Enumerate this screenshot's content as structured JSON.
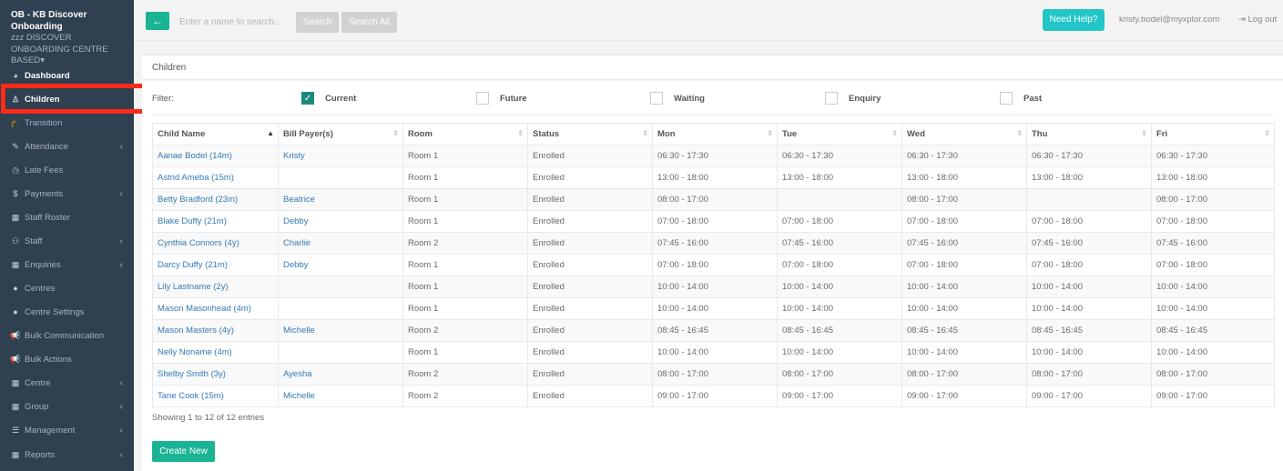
{
  "sidebar": {
    "org_name": "OB - KB Discover Onboarding",
    "org_sub": "zzz DISCOVER ONBOARDING CENTRE BASED",
    "org_caret": "▾",
    "items": [
      {
        "label": "Dashboard",
        "icon": "dashboard-icon",
        "glyph": "◕",
        "chevron": ""
      },
      {
        "label": "Children",
        "icon": "child-icon",
        "glyph": "♙",
        "chevron": ""
      },
      {
        "label": "Transition",
        "icon": "graduation-cap-icon",
        "glyph": "🎓",
        "chevron": ""
      },
      {
        "label": "Attendance",
        "icon": "edit-icon",
        "glyph": "✎",
        "chevron": "‹"
      },
      {
        "label": "Late Fees",
        "icon": "clock-icon",
        "glyph": "◷",
        "chevron": ""
      },
      {
        "label": "Payments",
        "icon": "dollar-icon",
        "glyph": "$",
        "chevron": "‹"
      },
      {
        "label": "Staff Roster",
        "icon": "calendar-icon",
        "glyph": "▦",
        "chevron": ""
      },
      {
        "label": "Staff",
        "icon": "sitemap-icon",
        "glyph": "⚇",
        "chevron": "‹"
      },
      {
        "label": "Enquiries",
        "icon": "grid-icon",
        "glyph": "▦",
        "chevron": "‹"
      },
      {
        "label": "Centres",
        "icon": "circle-icon",
        "glyph": "●",
        "chevron": ""
      },
      {
        "label": "Centre Settings",
        "icon": "circle-icon",
        "glyph": "●",
        "chevron": ""
      },
      {
        "label": "Bulk Communication",
        "icon": "bullhorn-icon",
        "glyph": "📢",
        "chevron": ""
      },
      {
        "label": "Bulk Actions",
        "icon": "bullhorn-icon",
        "glyph": "📢",
        "chevron": ""
      },
      {
        "label": "Centre",
        "icon": "grid-icon",
        "glyph": "▦",
        "chevron": "‹"
      },
      {
        "label": "Group",
        "icon": "grid-icon",
        "glyph": "▦",
        "chevron": "‹"
      },
      {
        "label": "Management",
        "icon": "list-icon",
        "glyph": "☰",
        "chevron": "‹"
      },
      {
        "label": "Reports",
        "icon": "grid-icon",
        "glyph": "▦",
        "chevron": "‹"
      }
    ]
  },
  "topbar": {
    "back_glyph": "←",
    "search_placeholder": "Enter a name to search...",
    "search_label": "Search",
    "search_all_label": "Search All",
    "help_label": "Need Help?",
    "email": "kristy.bodel@myxplor.com",
    "logout_label": "⇥  Log out"
  },
  "panel": {
    "title": "Children"
  },
  "filter": {
    "label": "Filter:",
    "options": [
      {
        "label": "Current",
        "checked": true
      },
      {
        "label": "Future",
        "checked": false
      },
      {
        "label": "Waiting",
        "checked": false
      },
      {
        "label": "Enquiry",
        "checked": false
      },
      {
        "label": "Past",
        "checked": false
      }
    ]
  },
  "table": {
    "columns": [
      "Child Name",
      "Bill Payer(s)",
      "Room",
      "Status",
      "Mon",
      "Tue",
      "Wed",
      "Thu",
      "Fri"
    ],
    "rows": [
      [
        "Aanae Bodel (14m)",
        "Kristy",
        "Room 1",
        "Enrolled",
        "06:30 - 17:30",
        "06:30 - 17:30",
        "06:30 - 17:30",
        "06:30 - 17:30",
        "06:30 - 17:30"
      ],
      [
        "Astrid Ameba (15m)",
        "",
        "Room 1",
        "Enrolled",
        "13:00 - 18:00",
        "13:00 - 18:00",
        "13:00 - 18:00",
        "13:00 - 18:00",
        "13:00 - 18:00"
      ],
      [
        "Betty Bradford (23m)",
        "Beatrice",
        "Room 1",
        "Enrolled",
        "08:00 - 17:00",
        "",
        "08:00 - 17:00",
        "",
        "08:00 - 17:00"
      ],
      [
        "Blake Duffy (21m)",
        "Debby",
        "Room 1",
        "Enrolled",
        "07:00 - 18:00",
        "07:00 - 18:00",
        "07:00 - 18:00",
        "07:00 - 18:00",
        "07:00 - 18:00"
      ],
      [
        "Cynthia Connors (4y)",
        "Charlie",
        "Room 2",
        "Enrolled",
        "07:45 - 16:00",
        "07:45 - 16:00",
        "07:45 - 16:00",
        "07:45 - 16:00",
        "07:45 - 16:00"
      ],
      [
        "Darcy Duffy (21m)",
        "Debby",
        "Room 1",
        "Enrolled",
        "07:00 - 18:00",
        "07:00 - 18:00",
        "07:00 - 18:00",
        "07:00 - 18:00",
        "07:00 - 18:00"
      ],
      [
        "Lily Lastname (2y)",
        "",
        "Room 1",
        "Enrolled",
        "10:00 - 14:00",
        "10:00 - 14:00",
        "10:00 - 14:00",
        "10:00 - 14:00",
        "10:00 - 14:00"
      ],
      [
        "Mason Masonhead (4m)",
        "",
        "Room 1",
        "Enrolled",
        "10:00 - 14:00",
        "10:00 - 14:00",
        "10:00 - 14:00",
        "10:00 - 14:00",
        "10:00 - 14:00"
      ],
      [
        "Mason Masters (4y)",
        "Michelle",
        "Room 2",
        "Enrolled",
        "08:45 - 16:45",
        "08:45 - 16:45",
        "08:45 - 16:45",
        "08:45 - 16:45",
        "08:45 - 16:45"
      ],
      [
        "Nelly Noname (4m)",
        "",
        "Room 1",
        "Enrolled",
        "10:00 - 14:00",
        "10:00 - 14:00",
        "10:00 - 14:00",
        "10:00 - 14:00",
        "10:00 - 14:00"
      ],
      [
        "Shelby Smith (3y)",
        "Ayesha",
        "Room 2",
        "Enrolled",
        "08:00 - 17:00",
        "08:00 - 17:00",
        "08:00 - 17:00",
        "08:00 - 17:00",
        "08:00 - 17:00"
      ],
      [
        "Tane Cook (15m)",
        "Michelle",
        "Room 2",
        "Enrolled",
        "09:00 - 17:00",
        "09:00 - 17:00",
        "09:00 - 17:00",
        "09:00 - 17:00",
        "09:00 - 17:00"
      ]
    ],
    "info": "Showing 1 to 12 of 12 entries"
  },
  "actions": {
    "create_label": "Create New"
  },
  "colors": {
    "sidebar_bg": "#2f4050",
    "accent": "#1ab394",
    "help": "#23c6c8",
    "highlight": "#ff2a1a",
    "link": "#337ab7"
  }
}
